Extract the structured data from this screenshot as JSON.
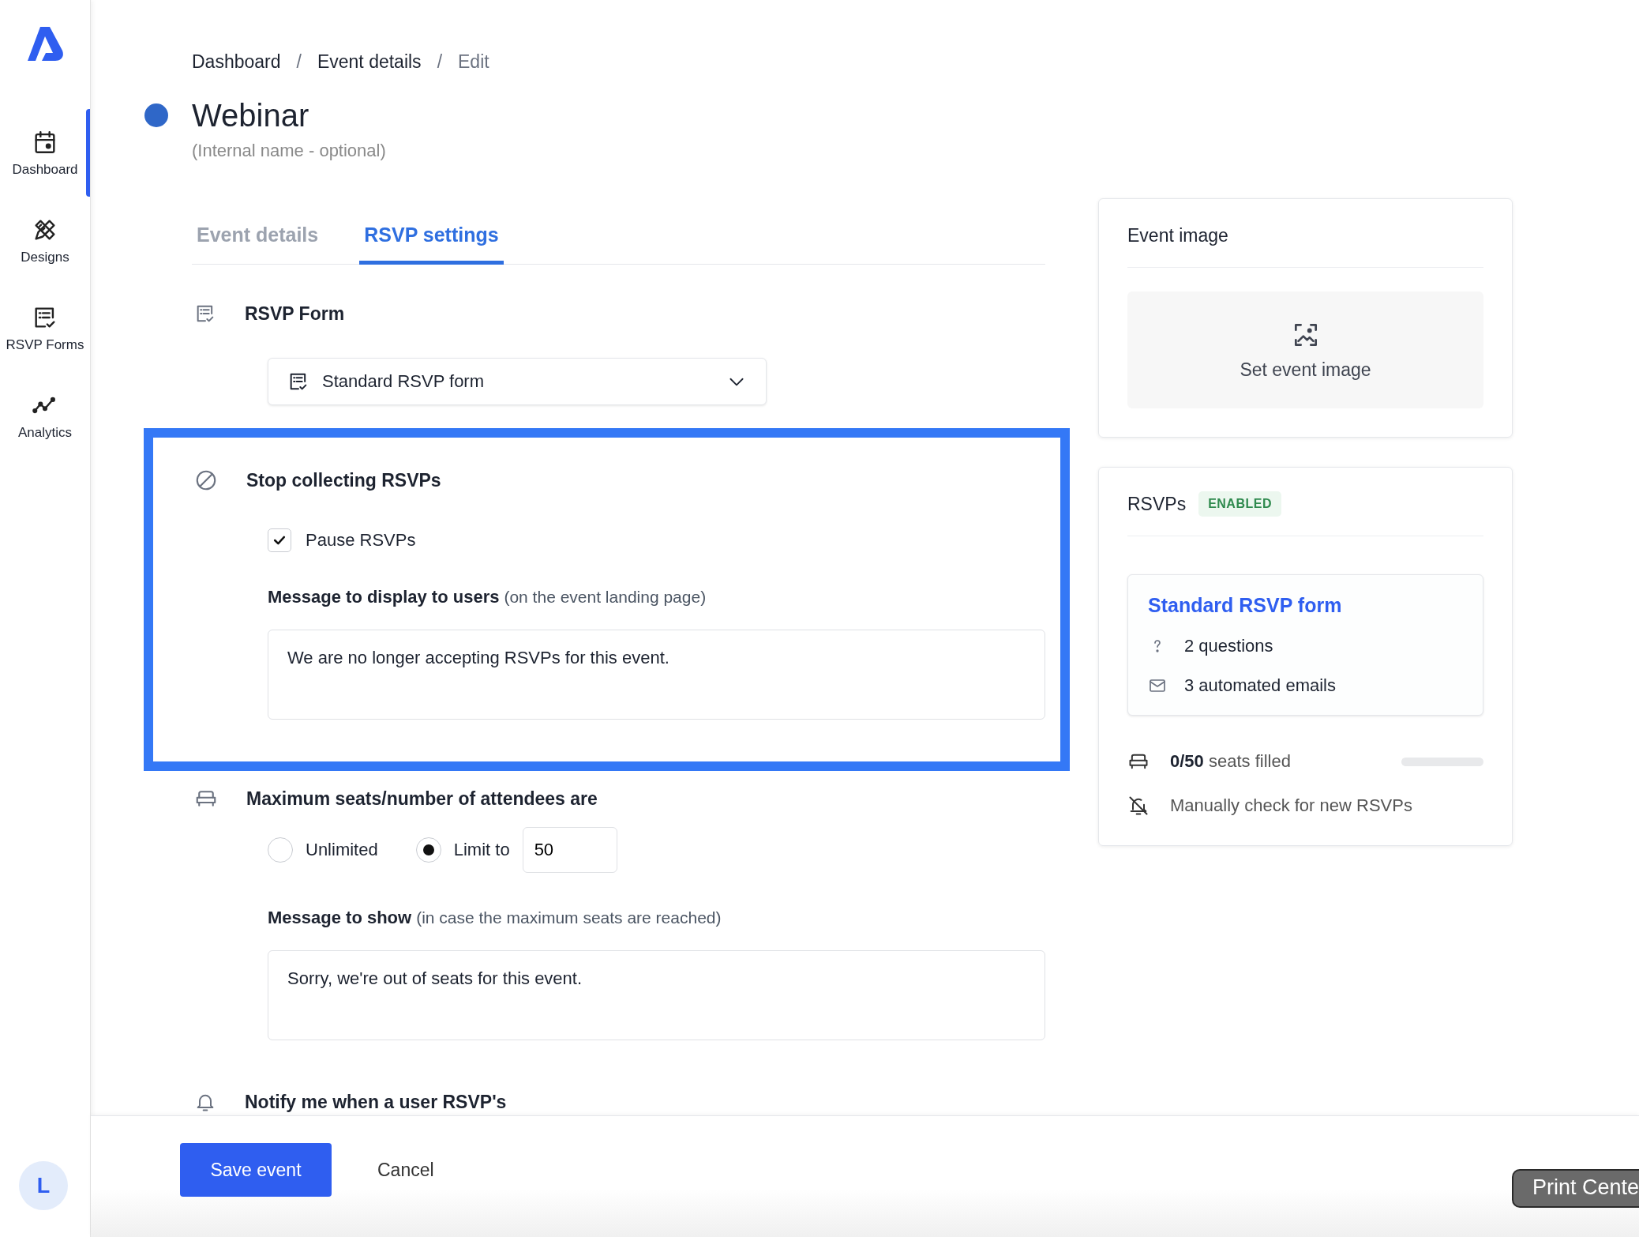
{
  "sidebar": {
    "items": [
      {
        "kind": "calendar",
        "label": "Dashboard",
        "selected": true
      },
      {
        "kind": "designs",
        "label": "Designs",
        "selected": false
      },
      {
        "kind": "forms",
        "label": "RSVP Forms",
        "selected": false
      },
      {
        "kind": "analytics",
        "label": "Analytics",
        "selected": false
      }
    ],
    "avatar": "L"
  },
  "breadcrumb": [
    {
      "label": "Dashboard",
      "current": false
    },
    {
      "separator": "/",
      "label": "Event details",
      "current": false
    },
    {
      "separator": "/",
      "label": "Edit",
      "current": true
    }
  ],
  "event": {
    "title": "Webinar",
    "subtitle": "(Internal name - optional)"
  },
  "tabs": [
    {
      "label": "Event details",
      "selected": false
    },
    {
      "label": "RSVP settings",
      "selected": true
    }
  ],
  "rsvp_form": {
    "heading": "RSVP Form",
    "select": {
      "value": "Standard RSVP form"
    }
  },
  "stop_collecting": {
    "heading": "Stop collecting RSVPs",
    "highlighted": true,
    "pause": {
      "label": "Pause RSVPs",
      "checked": true
    },
    "message": {
      "label": "Message to display to users",
      "hint": "(on the event landing page)",
      "value": "We are no longer accepting RSVPs for this event."
    }
  },
  "max_seats": {
    "heading": "Maximum seats/number of attendees are",
    "options": [
      {
        "label": "Unlimited",
        "selected": false
      },
      {
        "label": "Limit to",
        "selected": true
      }
    ],
    "limit": "50",
    "message": {
      "label": "Message to show",
      "hint": "(in case the maximum seats are reached)",
      "value": "Sorry, we're out of seats for this event."
    }
  },
  "notify": {
    "heading": "Notify me when a user RSVP's"
  },
  "event_image": {
    "title": "Event image",
    "button": "Set event image"
  },
  "rsvps": {
    "title": "RSVPs",
    "badge": "ENABLED",
    "form": {
      "name": "Standard RSVP form",
      "stats": [
        {
          "kind": "questions",
          "text": "2 questions"
        },
        {
          "kind": "emails",
          "text": "3 automated emails"
        }
      ]
    },
    "seats": {
      "count": "0/50",
      "label": "seats filled",
      "level": 0
    },
    "notify": "Manually check for new RSVPs"
  },
  "footer": {
    "save": "Save event",
    "cancel": "Cancel"
  },
  "tooltip": {
    "text": "Print Cente"
  }
}
